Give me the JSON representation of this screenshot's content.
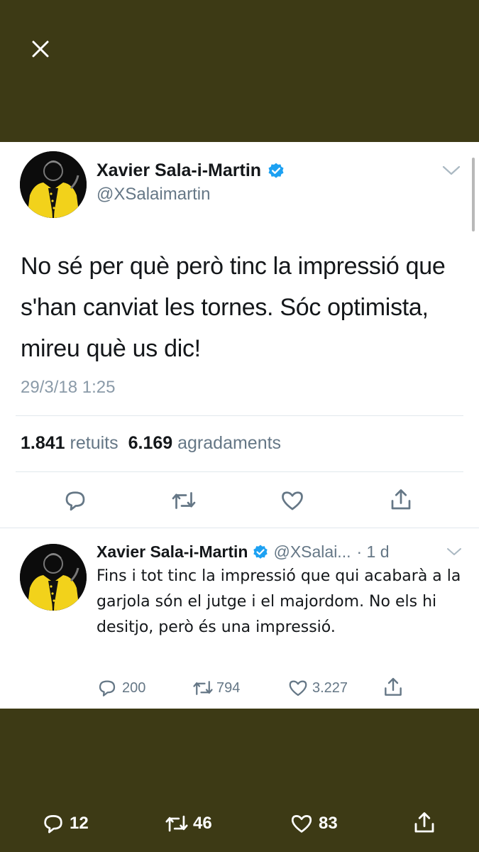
{
  "colors": {
    "overlay_bg": "#3d3a15",
    "card_bg": "#ffffff",
    "verified_blue": "#1da1f2",
    "text_primary": "#14171a",
    "text_secondary": "#657786",
    "icon_gray": "#657786"
  },
  "tweet": {
    "author_name": "Xavier Sala-i-Martin",
    "handle": "@XSalaimartin",
    "text": "No sé per què però tinc la impressió que s'han canviat les tornes. Sóc optimista, mireu què us dic!",
    "timestamp": "29/3/18 1:25",
    "retweets_count": "1.841",
    "retweets_label": "retuits",
    "likes_count": "6.169",
    "likes_label": "agradaments",
    "icons": [
      "reply-icon",
      "retweet-icon",
      "like-icon",
      "share-icon"
    ]
  },
  "reply": {
    "author_name": "Xavier Sala-i-Martin",
    "handle": "@XSalai...",
    "time": "· 1 d",
    "text": "Fins i tot tinc la impressió que qui acabarà a la garjola són el jutge i el majordom. No els hi desitjo, però és una impressió.",
    "replies": "200",
    "retweets": "794",
    "likes": "3.227"
  },
  "bottom_bar": {
    "replies": "12",
    "retweets": "46",
    "likes": "83"
  }
}
